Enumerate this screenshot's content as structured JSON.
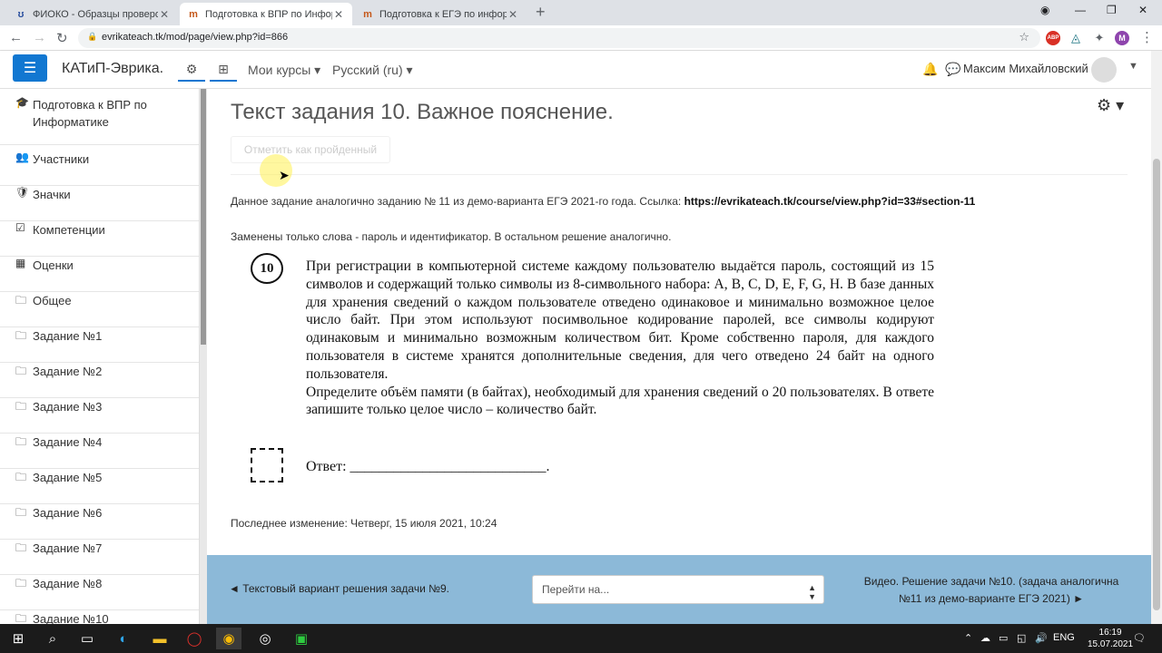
{
  "browser": {
    "tabs": [
      {
        "title": "ФИОКО - Образцы проверочн",
        "active": false
      },
      {
        "title": "Подготовка к ВПР по Информа",
        "active": true
      },
      {
        "title": "Подготовка к ЕГЭ по информат",
        "active": false
      }
    ],
    "url": "evrikateach.tk/mod/page/view.php?id=866",
    "profile_letter": "M"
  },
  "navbar": {
    "brand": "КАТиП-Эврика.",
    "my_courses": "Мои курсы",
    "language": "Русский (ru)",
    "user_name": "Максим Михайловский"
  },
  "sidebar": {
    "items": [
      {
        "icon": "graduation-cap-icon",
        "glyph": "🎓",
        "label": "Подготовка к ВПР по Информатике"
      },
      {
        "icon": "users-icon",
        "glyph": "👥",
        "label": "Участники"
      },
      {
        "icon": "shield-icon",
        "glyph": "🛡",
        "label": "Значки"
      },
      {
        "icon": "check-square-icon",
        "glyph": "☑",
        "label": "Компетенции"
      },
      {
        "icon": "table-icon",
        "glyph": "▦",
        "label": "Оценки"
      },
      {
        "icon": "folder-icon",
        "glyph": "🗀",
        "label": "Общее"
      },
      {
        "icon": "folder-icon",
        "glyph": "🗀",
        "label": "Задание №1"
      },
      {
        "icon": "folder-icon",
        "glyph": "🗀",
        "label": "Задание №2"
      },
      {
        "icon": "folder-icon",
        "glyph": "🗀",
        "label": "Задание №3"
      },
      {
        "icon": "folder-icon",
        "glyph": "🗀",
        "label": "Задание №4"
      },
      {
        "icon": "folder-icon",
        "glyph": "🗀",
        "label": "Задание №5"
      },
      {
        "icon": "folder-icon",
        "glyph": "🗀",
        "label": "Задание №6"
      },
      {
        "icon": "folder-icon",
        "glyph": "🗀",
        "label": "Задание №7"
      },
      {
        "icon": "folder-icon",
        "glyph": "🗀",
        "label": "Задание №8"
      },
      {
        "icon": "folder-icon",
        "glyph": "🗀",
        "label": "Задание №10"
      }
    ]
  },
  "main": {
    "title": "Текст задания 10. Важное пояснение.",
    "mark_done": "Отметить как пройденный",
    "intro_text": "Данное задание аналогично заданию № 11 из демо-варианта ЕГЭ 2021-го года. Ссылка: ",
    "intro_link": "https://evrikateach.tk/course/view.php?id=33#section-11",
    "note": "Заменены только слова - пароль и идентификатор. В остальном решение аналогично.",
    "task_number": "10",
    "task_text_1": "При регистрации в компьютерной системе каждому пользователю выдаётся пароль, состоящий из 15 символов и содержащий только символы из 8-символьного набора: A, B, C, D, E, F, G, H. В базе данных для хранения сведений о каждом пользователе отведено одинаковое и минимально возможное целое число байт. При этом используют посимвольное кодирование паролей, все символы кодируют одинаковым и минимально возможным количеством бит. Кроме собственно пароля, для каждого пользователя в системе хранятся дополнительные сведения, для чего отведено 24 байт на одного пользователя.",
    "task_text_2": "Определите объём памяти (в байтах), необходимый для хранения сведений о 20 пользователях. В ответе запишите только целое число – количество байт.",
    "answer_label": "Ответ: ___________________________.",
    "last_modified": "Последнее изменение: Четверг, 15 июля 2021, 10:24"
  },
  "footer": {
    "prev": "◄ Текстовый вариант решения задачи №9.",
    "jump_placeholder": "Перейти на...",
    "next": "Видео. Решение задачи №10. (задача аналогична №11 из демо-варианте ЕГЭ 2021) ►"
  },
  "taskbar": {
    "lang": "ENG",
    "time": "16:19",
    "date": "15.07.2021"
  },
  "colors": {
    "accent": "#1177d1",
    "footer_bg": "#8cb9d8"
  }
}
